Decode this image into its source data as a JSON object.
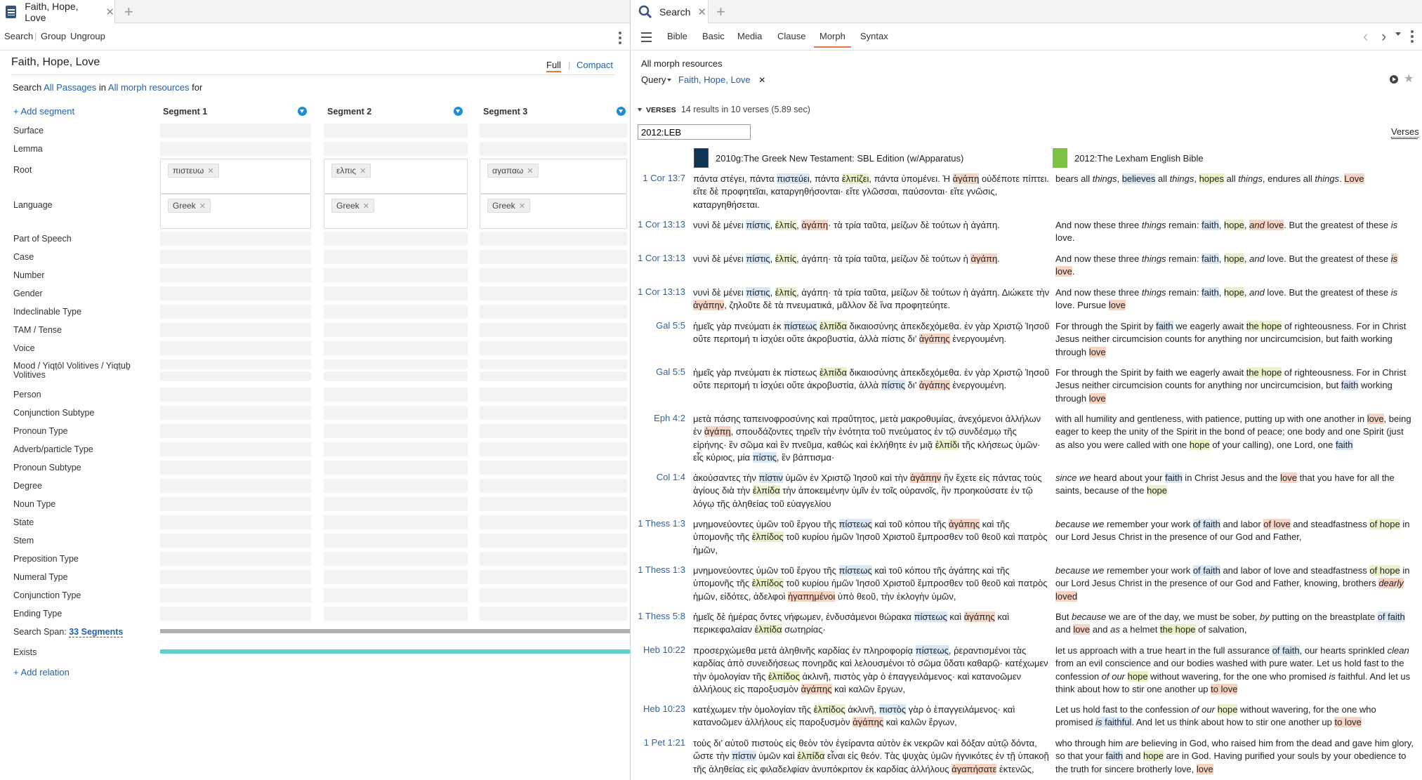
{
  "left": {
    "tab": {
      "title": "Faith, Hope, Love"
    },
    "toolbar": {
      "search": "Search",
      "group": "Group",
      "ungroup": "Ungroup"
    },
    "search_name": "Faith, Hope, Love",
    "view_full": "Full",
    "view_compact": "Compact",
    "search_prefix": "Search",
    "scope": "All Passages",
    "in_word": "in",
    "resources": "All morph resources",
    "for_word": "for",
    "add_segment": "+ Add segment",
    "segments": [
      {
        "title": "Segment 1",
        "root": "πιστευω",
        "language": "Greek"
      },
      {
        "title": "Segment 2",
        "root": "ελπις",
        "language": "Greek"
      },
      {
        "title": "Segment 3",
        "root": "αγαπαω",
        "language": "Greek"
      }
    ],
    "rows": {
      "surface": "Surface",
      "lemma": "Lemma",
      "root": "Root",
      "language": "Language",
      "list": [
        "Part of Speech",
        "Case",
        "Number",
        "Gender",
        "Indeclinable Type",
        "TAM / Tense",
        "Voice"
      ],
      "mood": "Mood / Yiqṭōl Volitives / Yiqṭuḇ Volitives",
      "list2": [
        "Person",
        "Conjunction Subtype",
        "Pronoun Type",
        "Adverb/particle Type",
        "Pronoun Subtype",
        "Degree",
        "Noun Type",
        "State",
        "Stem",
        "Preposition Type",
        "Numeral Type",
        "Conjunction Type",
        "Ending Type"
      ]
    },
    "span_label": "Search Span:",
    "span_value": "33 Segments",
    "exists": "Exists",
    "add_relation": "+ Add relation"
  },
  "right": {
    "tab": {
      "title": "Search"
    },
    "kinds": [
      "Bible",
      "Basic",
      "Media",
      "Clause",
      "Morph",
      "Syntax"
    ],
    "active_kind": "Morph",
    "scope": "All morph resources",
    "query_label": "Query",
    "query_value": "Faith, Hope, Love",
    "verses_label": "VERSES",
    "results": "14 results in 10 verses (5.89 sec)",
    "filter_value": "2012:LEB",
    "verses_link": "Verses",
    "col_greek": "2010g:The Greek New Testament: SBL Edition (w/Apparatus)",
    "col_english": "2012:The Lexham English Bible",
    "results_list": [
      {
        "ref": "1 Cor 13:7",
        "greek": "πάντα στέγει, πάντα [[f:πιστεύει]], πάντα [[h:ἐλπίζει]], πάντα ὑπομένει. Ἡ [[l:ἀγάπη]] οὐδέποτε πίπτει. εἴτε δὲ προφητεῖαι, καταργηθήσονται· εἴτε γλῶσσαι, παύσονται· εἴτε γνῶσις, καταργηθήσεται.",
        "english": "bears all *things*, [[f:believes]] all *things*, [[h:hopes]] all *things*, endures all *things*. [[l:Love]]"
      },
      {
        "ref": "1 Cor 13:13",
        "greek": "νυνὶ δὲ μένει [[f:πίστις]], [[h:ἐλπίς]], [[l:ἀγάπη]]· τὰ τρία ταῦτα, μείζων δὲ τούτων ἡ ἀγάπη.",
        "english": "And now these three *things* remain: [[f:faith]], [[h:hope]], [[l:*and* love]]. But the greatest of these *is* love."
      },
      {
        "ref": "1 Cor 13:13",
        "greek": "νυνὶ δὲ μένει [[f:πίστις]], [[h:ἐλπίς]], ἀγάπη· τὰ τρία ταῦτα, μείζων δὲ τούτων ἡ [[l:ἀγάπη]].",
        "english": "And now these three *things* remain: [[f:faith]], [[h:hope]], *and* love. But the greatest of these [[l:*is* love]]."
      },
      {
        "ref": "1 Cor 13:13",
        "greek": "νυνὶ δὲ μένει [[f:πίστις]], [[h:ἐλπίς]], ἀγάπη· τὰ τρία ταῦτα, μείζων δὲ τούτων ἡ ἀγάπη. Διώκετε τὴν [[l:ἀγάπην]], ζηλοῦτε δὲ τὰ πνευματικά, μᾶλλον δὲ ἵνα προφητεύητε.",
        "english": "And now these three *things* remain: [[f:faith]], [[h:hope]], *and* love. But the greatest of these *is* love. Pursue [[l:love]]"
      },
      {
        "ref": "Gal 5:5",
        "greek": "ἡμεῖς γὰρ πνεύματι ἐκ [[f:πίστεως]] [[h:ἐλπίδα]] δικαιοσύνης ἀπεκδεχόμεθα. ἐν γὰρ Χριστῷ Ἰησοῦ οὔτε περιτομή τι ἰσχύει οὔτε ἀκροβυστία, ἀλλὰ πίστις δι’ [[l:ἀγάπης]] ἐνεργουμένη.",
        "english": "For through the Spirit by [[f:faith]] we eagerly await [[h:the hope]] of righteousness. For in Christ Jesus neither circumcision counts for anything nor uncircumcision, but faith working through [[l:love]]"
      },
      {
        "ref": "Gal 5:5",
        "greek": "ἡμεῖς γὰρ πνεύματι ἐκ πίστεως [[h:ἐλπίδα]] δικαιοσύνης ἀπεκδεχόμεθα. ἐν γὰρ Χριστῷ Ἰησοῦ οὔτε περιτομή τι ἰσχύει οὔτε ἀκροβυστία, ἀλλὰ [[f:πίστις]] δι’ [[l:ἀγάπης]] ἐνεργουμένη.",
        "english": "For through the Spirit by faith we eagerly await [[h:the hope]] of righteousness. For in Christ Jesus neither circumcision counts for anything nor uncircumcision, but [[f:faith]] working through [[l:love]]"
      },
      {
        "ref": "Eph 4:2",
        "greek": "μετὰ πάσης ταπεινοφροσύνης καὶ πραΰτητος, μετὰ μακροθυμίας, ἀνεχόμενοι ἀλλήλων ἐν [[l:ἀγάπῃ]], σπουδάζοντες τηρεῖν τὴν ἑνότητα τοῦ πνεύματος ἐν τῷ συνδέσμῳ τῆς εἰρήνης· ἓν σῶμα καὶ ἓν πνεῦμα, καθὼς καὶ ἐκλήθητε ἐν μιᾷ [[h:ἐλπίδι]] τῆς κλήσεως ὑμῶν· εἷς κύριος, μία [[f:πίστις]], ἓν βάπτισμα·",
        "english": "with all humility and gentleness, with patience, putting up with one another in [[l:love]], being eager to keep the unity of the Spirit in the bond of peace; one body and one Spirit (just as also you were called with one [[h:hope]] of your calling), one Lord, one [[f:faith]]"
      },
      {
        "ref": "Col 1:4",
        "greek": "ἀκούσαντες τὴν [[f:πίστιν]] ὑμῶν ἐν Χριστῷ Ἰησοῦ καὶ τὴν [[l:ἀγάπην]] ἣν ἔχετε εἰς πάντας τοὺς ἁγίους διὰ τὴν [[h:ἐλπίδα]] τὴν ἀποκειμένην ὑμῖν ἐν τοῖς οὐρανοῖς, ἣν προηκούσατε ἐν τῷ λόγῳ τῆς ἀληθείας τοῦ εὐαγγελίου",
        "english": "*since we* heard about your [[f:faith]] in Christ Jesus and the [[l:love]] that you have for all the saints, because of the [[h:hope]]"
      },
      {
        "ref": "1 Thess 1:3",
        "greek": "μνημονεύοντες ὑμῶν τοῦ ἔργου τῆς [[f:πίστεως]] καὶ τοῦ κόπου τῆς [[l:ἀγάπης]] καὶ τῆς ὑπομονῆς τῆς [[h:ἐλπίδος]] τοῦ κυρίου ἡμῶν Ἰησοῦ Χριστοῦ ἔμπροσθεν τοῦ θεοῦ καὶ πατρὸς ἡμῶν,",
        "english": "*because we* remember your work [[f:of faith]] and labor [[l:of love]] and steadfastness [[h:of hope]] in our Lord Jesus Christ in the presence of our God and Father,"
      },
      {
        "ref": "1 Thess 1:3",
        "greek": "μνημονεύοντες ὑμῶν τοῦ ἔργου τῆς [[f:πίστεως]] καὶ τοῦ κόπου τῆς ἀγάπης καὶ τῆς ὑπομονῆς τῆς [[h:ἐλπίδος]] τοῦ κυρίου ἡμῶν Ἰησοῦ Χριστοῦ ἔμπροσθεν τοῦ θεοῦ καὶ πατρὸς ἡμῶν, εἰδότες, ἀδελφοὶ [[l:ἠγαπημένοι]] ὑπὸ θεοῦ, τὴν ἐκλογὴν ὑμῶν,",
        "english": "*because we* remember your work [[f:of faith]] and labor of love and steadfastness [[h:of hope]] in our Lord Jesus Christ in the presence of our God and Father, knowing, brothers [[l:*dearly* loved]]"
      },
      {
        "ref": "1 Thess 5:8",
        "greek": "ἡμεῖς δὲ ἡμέρας ὄντες νήφωμεν, ἐνδυσάμενοι θώρακα [[f:πίστεως]] καὶ [[l:ἀγάπης]] καὶ περικεφαλαίαν [[h:ἐλπίδα]] σωτηρίας·",
        "english": "But *because* we are of the day, we must be sober, *by* putting on the breastplate [[f:of faith]] and [[l:love]] and *as* a helmet [[h:the hope]] of salvation,"
      },
      {
        "ref": "Heb 10:22",
        "greek": "προσερχώμεθα μετὰ ἀληθινῆς καρδίας ἐν πληροφορίᾳ [[f:πίστεως]], ῥεραντισμένοι τὰς καρδίας ἀπὸ συνειδήσεως πονηρᾶς καὶ λελουσμένοι τὸ σῶμα ὕδατι καθαρῷ· κατέχωμεν τὴν ὁμολογίαν τῆς [[h:ἐλπίδος]] ἀκλινῆ, πιστὸς γὰρ ὁ ἐπαγγειλάμενος· καὶ κατανοῶμεν ἀλλήλους εἰς παροξυσμὸν [[l:ἀγάπης]] καὶ καλῶν ἔργων,",
        "english": "let us approach with a true heart in the full assurance [[f:of faith]], our hearts sprinkled *clean* from an evil conscience and our bodies washed with pure water. Let us hold fast to the confession *of our* [[h:hope]] without wavering, for the one who promised *is* faithful. And let us think about how to stir one another up [[l:to love]]"
      },
      {
        "ref": "Heb 10:23",
        "greek": "κατέχωμεν τὴν ὁμολογίαν τῆς [[h:ἐλπίδος]] ἀκλινῆ, [[f:πιστὸς]] γὰρ ὁ ἐπαγγειλάμενος· καὶ κατανοῶμεν ἀλλήλους εἰς παροξυσμὸν [[l:ἀγάπης]] καὶ καλῶν ἔργων,",
        "english": "Let us hold fast to the confession *of our* [[h:hope]] without wavering, for the one who promised [[f:*is* faithful]]. And let us think about how to stir one another up [[l:to love]]"
      },
      {
        "ref": "1 Pet 1:21",
        "greek": "τοὺς δι’ αὐτοῦ πιστοὺς εἰς θεὸν τὸν ἐγείραντα αὐτὸν ἐκ νεκρῶν καὶ δόξαν αὐτῷ δόντα, ὥστε τὴν [[f:πίστιν]] ὑμῶν καὶ [[h:ἐλπίδα]] εἶναι εἰς θεόν. Τὰς ψυχὰς ὑμῶν ἡγνικότες ἐν τῇ ὑπακοῇ τῆς ἀληθείας εἰς φιλαδελφίαν ἀνυπόκριτον ἐκ καρδίας ἀλλήλους [[l:ἀγαπήσατε]] ἐκτενῶς,",
        "english": "who through him *are* believing in God, who raised him from the dead and gave him glory, so that your [[f:faith]] and [[h:hope]] are in God. Having purified your souls by your obedience to the truth for sincere brotherly love, [[l:love]]"
      }
    ]
  }
}
